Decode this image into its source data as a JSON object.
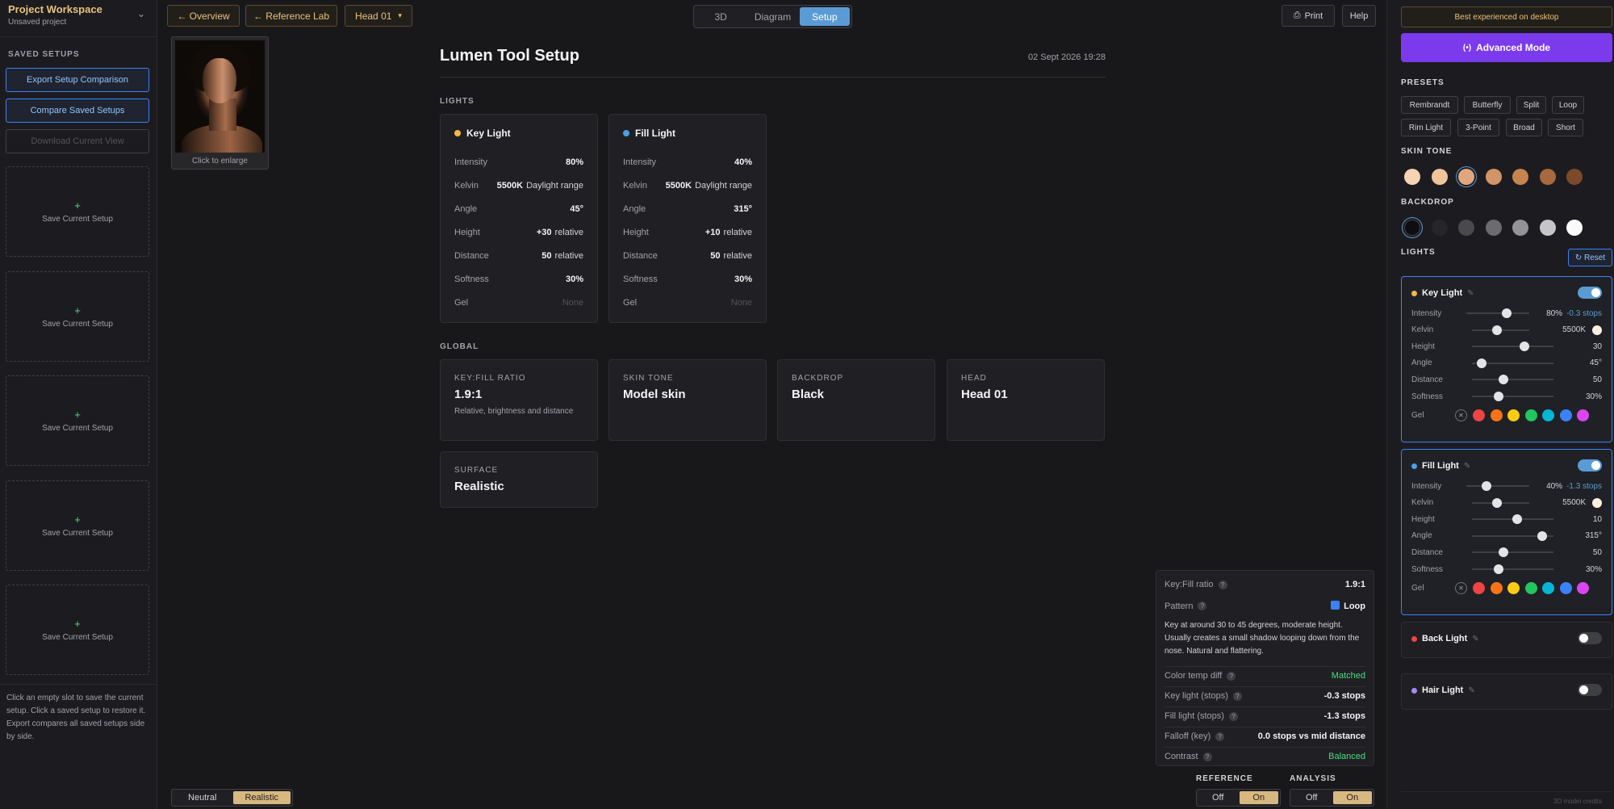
{
  "left": {
    "project_title": "Project Workspace",
    "project_sub": "Unsaved project",
    "saved_setups_label": "SAVED SETUPS",
    "export_btn": "Export Setup Comparison",
    "compare_btn": "Compare Saved Setups",
    "download_btn": "Download Current View",
    "slots": [
      "Save Current Setup",
      "Save Current Setup",
      "Save Current Setup",
      "Save Current Setup",
      "Save Current Setup"
    ],
    "help": "Click an empty slot to save the current setup. Click a saved setup to restore it. Export compares all saved setups side by side."
  },
  "topbar": {
    "overview": "← Overview",
    "reference_lab": "← Reference Lab",
    "head": "Head 01",
    "tabs": [
      "3D",
      "Diagram",
      "Setup"
    ],
    "print": "Print",
    "help": "Help"
  },
  "photo": {
    "caption": "Click to enlarge"
  },
  "main": {
    "title": "Lumen Tool Setup",
    "date": "02 Sept 2026  19:28",
    "lights_label": "LIGHTS",
    "global_label": "GLOBAL"
  },
  "key_card": {
    "title": "Key Light",
    "color": "#f5b942",
    "rows": [
      {
        "k": "Intensity",
        "v": "80%",
        "u": ""
      },
      {
        "k": "Kelvin",
        "v": "5500K",
        "u": "Daylight range"
      },
      {
        "k": "Angle",
        "v": "45°",
        "u": ""
      },
      {
        "k": "Height",
        "v": "+30",
        "u": "relative"
      },
      {
        "k": "Distance",
        "v": "50",
        "u": "relative"
      },
      {
        "k": "Softness",
        "v": "30%",
        "u": ""
      },
      {
        "k": "Gel",
        "v": "None",
        "u": ""
      }
    ]
  },
  "fill_card": {
    "title": "Fill Light",
    "color": "#4a9fe8",
    "rows": [
      {
        "k": "Intensity",
        "v": "40%",
        "u": ""
      },
      {
        "k": "Kelvin",
        "v": "5500K",
        "u": "Daylight range"
      },
      {
        "k": "Angle",
        "v": "315°",
        "u": ""
      },
      {
        "k": "Height",
        "v": "+10",
        "u": "relative"
      },
      {
        "k": "Distance",
        "v": "50",
        "u": "relative"
      },
      {
        "k": "Softness",
        "v": "30%",
        "u": ""
      },
      {
        "k": "Gel",
        "v": "None",
        "u": ""
      }
    ]
  },
  "global": {
    "ratio": {
      "label": "KEY:FILL RATIO",
      "value": "1.9:1",
      "desc": "Relative, brightness and distance"
    },
    "skin": {
      "label": "SKIN TONE",
      "value": "Model skin"
    },
    "backdrop": {
      "label": "BACKDROP",
      "value": "Black"
    },
    "head": {
      "label": "HEAD",
      "value": "Head 01"
    },
    "surface": {
      "label": "SURFACE",
      "value": "Realistic"
    }
  },
  "analysis": {
    "ratio_k": "Key:Fill ratio",
    "ratio_v": "1.9:1",
    "pattern_k": "Pattern",
    "pattern_v": "Loop",
    "pattern_desc": "Key at around 30 to 45 degrees, moderate height. Usually creates a small shadow looping down from the nose. Natural and flattering.",
    "ct_k": "Color temp diff",
    "ct_v": "Matched",
    "ks_k": "Key light (stops)",
    "ks_v": "-0.3 stops",
    "fs_k": "Fill light (stops)",
    "fs_v": "-1.3 stops",
    "fo_k": "Falloff (key)",
    "fo_v": "0.0 stops vs mid distance",
    "co_k": "Contrast",
    "co_v": "Balanced"
  },
  "bottom": {
    "surface_opts": [
      "Neutral",
      "Realistic"
    ],
    "reference_label": "REFERENCE",
    "analysis_label": "ANALYSIS",
    "off": "Off",
    "on": "On"
  },
  "right": {
    "banner": "Best experienced on desktop",
    "advanced": "Advanced Mode",
    "presets_label": "PRESETS",
    "presets_row1": [
      "Rembrandt",
      "Butterfly",
      "Split",
      "Loop"
    ],
    "presets_row2": [
      "Rim Light",
      "3-Point",
      "Broad",
      "Short"
    ],
    "skin_label": "SKIN TONE",
    "skin_colors": [
      "#f6d3b3",
      "#f0c39a",
      "#e0a67e",
      "#d39468",
      "#c68450",
      "#a8693e",
      "#7c4a2a"
    ],
    "backdrop_label": "BACKDROP",
    "backdrop_colors": [
      "#0e0e10",
      "#262628",
      "#4a4a4d",
      "#6c6c70",
      "#949498",
      "#c6c6c8",
      "#fafafa"
    ],
    "lights_label": "LIGHTS",
    "reset": "↻ Reset",
    "key": {
      "title": "Key Light",
      "color": "#f5b942",
      "rows": [
        {
          "k": "Intensity",
          "v": "80%",
          "stops": "-0.3 stops",
          "level": 0.62
        },
        {
          "k": "Kelvin",
          "v": "5500K",
          "level": 0.42
        },
        {
          "k": "Height",
          "v": "30",
          "level": 0.63
        },
        {
          "k": "Angle",
          "v": "45°",
          "level": 0.12
        },
        {
          "k": "Distance",
          "v": "50",
          "level": 0.38
        },
        {
          "k": "Softness",
          "v": "30%",
          "level": 0.32
        }
      ],
      "gel_label": "Gel"
    },
    "fill": {
      "title": "Fill Light",
      "color": "#4a9fe8",
      "rows": [
        {
          "k": "Intensity",
          "v": "40%",
          "stops": "-1.3 stops",
          "level": 0.31
        },
        {
          "k": "Kelvin",
          "v": "5500K",
          "level": 0.42
        },
        {
          "k": "Height",
          "v": "10",
          "level": 0.54
        },
        {
          "k": "Angle",
          "v": "315°",
          "level": 0.84
        },
        {
          "k": "Distance",
          "v": "50",
          "level": 0.38
        },
        {
          "k": "Softness",
          "v": "30%",
          "level": 0.32
        }
      ],
      "gel_label": "Gel"
    },
    "gel_colors": [
      "#ef4444",
      "#f97316",
      "#facc15",
      "#22c55e",
      "#06b6d4",
      "#3b82f6",
      "#d946ef"
    ],
    "back": {
      "title": "Back Light",
      "color": "#ef4444"
    },
    "hair": {
      "title": "Hair Light",
      "color": "#a78bfa"
    },
    "credits": "3D model credits"
  }
}
